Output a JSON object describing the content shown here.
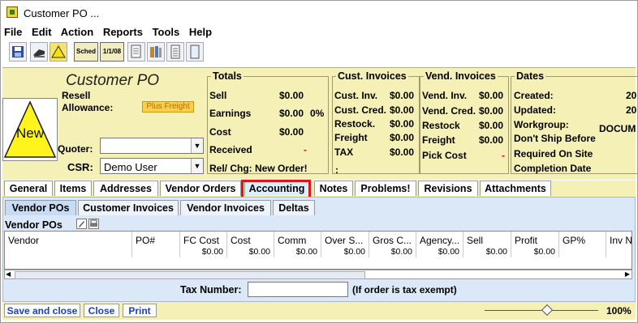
{
  "window": {
    "title": "Customer PO ..."
  },
  "menu": [
    "File",
    "Edit",
    "Action",
    "Reports",
    "Tools",
    "Help"
  ],
  "toolbar": {
    "sched_label": "Sched",
    "date_label": "1/1/08"
  },
  "header": {
    "title": "Customer PO",
    "resell": "Resell",
    "allowance": "Allowance:",
    "plus_freight": "Plus Freight",
    "new_badge": "New",
    "quoter_label": "Quoter:",
    "quoter_value": "",
    "csr_label": "CSR:",
    "csr_value": "Demo User"
  },
  "totals": {
    "legend": "Totals",
    "sell_label": "Sell",
    "sell": "$0.00",
    "earnings_label": "Earnings",
    "earnings": "$0.00",
    "earnings_pct": "0%",
    "cost_label": "Cost",
    "cost": "$0.00",
    "received_label": "Received",
    "received": "-",
    "relchg": "Rel/ Chg: New Order!"
  },
  "cust_invoices": {
    "legend": "Cust. Invoices",
    "rows": [
      {
        "label": "Cust. Inv.",
        "value": "$0.00"
      },
      {
        "label": "Cust. Cred.",
        "value": "$0.00"
      },
      {
        "label": "Restock.",
        "value": "$0.00"
      },
      {
        "label": "Freight",
        "value": "$0.00"
      },
      {
        "label": "TAX",
        "value": "$0.00"
      }
    ],
    "colon": ":"
  },
  "vend_invoices": {
    "legend": "Vend. Invoices",
    "rows": [
      {
        "label": "Vend. Inv.",
        "value": "$0.00"
      },
      {
        "label": "Vend. Cred.",
        "value": "$0.00"
      },
      {
        "label": "Restock",
        "value": "$0.00"
      },
      {
        "label": "Freight",
        "value": "$0.00"
      }
    ],
    "pick_cost_label": "Pick Cost",
    "pick_cost": "-"
  },
  "dates": {
    "legend": "Dates",
    "created_label": "Created:",
    "created": "20",
    "updated_label": "Updated:",
    "updated": "20",
    "workgroup_label": "Workgroup:",
    "workgroup": "DOCUM",
    "dont_ship_label": "Don't Ship Before",
    "required_label": "Required On Site",
    "completion_label": "Completion Date"
  },
  "tabs": [
    "General",
    "Items",
    "Addresses",
    "Vendor Orders",
    "Accounting",
    "Notes",
    "Problems!",
    "Revisions",
    "Attachments"
  ],
  "subtabs": [
    "Vendor POs",
    "Customer Invoices",
    "Vendor Invoices",
    "Deltas"
  ],
  "vendor_pos": {
    "label": "Vendor POs",
    "columns": [
      {
        "name": "Vendor",
        "total": ""
      },
      {
        "name": "PO#",
        "total": ""
      },
      {
        "name": "FC Cost",
        "total": "$0.00"
      },
      {
        "name": "Cost",
        "total": "$0.00"
      },
      {
        "name": "Comm",
        "total": "$0.00"
      },
      {
        "name": "Over S...",
        "total": "$0.00"
      },
      {
        "name": "Gros C...",
        "total": "$0.00"
      },
      {
        "name": "Agency...",
        "total": "$0.00"
      },
      {
        "name": "Sell",
        "total": "$0.00"
      },
      {
        "name": "Profit",
        "total": "$0.00"
      },
      {
        "name": "GP%",
        "total": ""
      },
      {
        "name": "Inv N",
        "total": ""
      }
    ]
  },
  "tax": {
    "label": "Tax Number:",
    "value": "",
    "note": "(If order is tax exempt)"
  },
  "buttons": {
    "save_close": "Save and close",
    "close": "Close",
    "print": "Print"
  },
  "zoom": {
    "value": "100%",
    "level": 0.55
  }
}
